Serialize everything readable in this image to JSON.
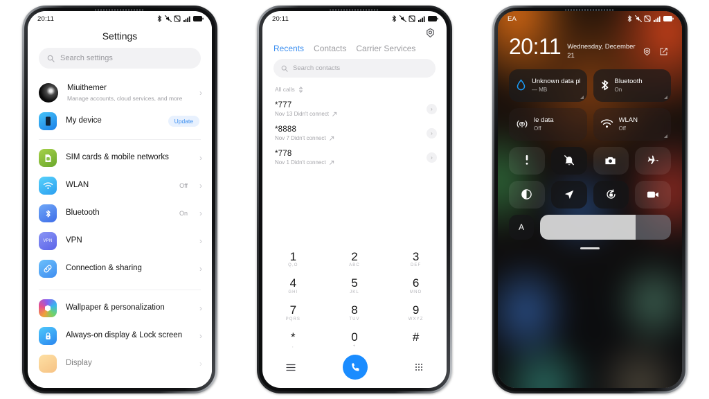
{
  "phones": {
    "settings": {
      "statusbar": {
        "time": "20:11",
        "icons": [
          "bluetooth-icon",
          "mute-icon",
          "no-sim-icon",
          "signal-icon",
          "battery-icon"
        ]
      },
      "title": "Settings",
      "search": {
        "placeholder": "Search settings",
        "icon": "search-icon"
      },
      "account": {
        "name": "Miuithemer",
        "subtitle": "Manage accounts, cloud services, and more",
        "avatar": "user-avatar"
      },
      "device": {
        "label": "My device",
        "badge": "Update",
        "icon": "phone-icon"
      },
      "items": [
        {
          "label": "SIM cards & mobile networks",
          "value": "",
          "icon": "sim-icon",
          "color": "#8bc34a"
        },
        {
          "label": "WLAN",
          "value": "Off",
          "icon": "wifi-icon",
          "color": "#4fc3f7"
        },
        {
          "label": "Bluetooth",
          "value": "On",
          "icon": "bluetooth-icon",
          "color": "#5b8dee"
        },
        {
          "label": "VPN",
          "value": "",
          "icon": "vpn-icon",
          "color": "#6c7bf0"
        },
        {
          "label": "Connection & sharing",
          "value": "",
          "icon": "link-icon",
          "color": "#5aa9f5"
        }
      ],
      "items2": [
        {
          "label": "Wallpaper & personalization",
          "value": "",
          "icon": "wallpaper-icon",
          "color": "#e75fa0"
        },
        {
          "label": "Always-on display & Lock screen",
          "value": "",
          "icon": "lock-icon",
          "color": "#38a8f0"
        },
        {
          "label": "Display",
          "value": "",
          "icon": "display-icon",
          "color": "#f5a623"
        }
      ]
    },
    "dialer": {
      "statusbar": {
        "time": "20:11"
      },
      "settings_icon": "gear-icon",
      "tabs": [
        {
          "label": "Recents",
          "active": true
        },
        {
          "label": "Contacts",
          "active": false
        },
        {
          "label": "Carrier Services",
          "active": false
        }
      ],
      "search": {
        "placeholder": "Search contacts",
        "icon": "search-icon"
      },
      "filter": {
        "label": "All calls",
        "icon": "sort-icon"
      },
      "calls": [
        {
          "number": "*777",
          "detail": "Nov 13 Didn't connect",
          "type": "outgoing-call-icon"
        },
        {
          "number": "*8888",
          "detail": "Nov 7 Didn't connect",
          "type": "outgoing-call-icon"
        },
        {
          "number": "*778",
          "detail": "Nov 1 Didn't connect",
          "type": "outgoing-call-icon"
        }
      ],
      "keypad": [
        {
          "num": "1",
          "letters": "Q,O"
        },
        {
          "num": "2",
          "letters": "ABC"
        },
        {
          "num": "3",
          "letters": "DEF"
        },
        {
          "num": "4",
          "letters": "GHI"
        },
        {
          "num": "5",
          "letters": "JKL"
        },
        {
          "num": "6",
          "letters": "MNO"
        },
        {
          "num": "7",
          "letters": "PQRS"
        },
        {
          "num": "8",
          "letters": "TUV"
        },
        {
          "num": "9",
          "letters": "WXYZ"
        },
        {
          "num": "*",
          "letters": ","
        },
        {
          "num": "0",
          "letters": "+"
        },
        {
          "num": "#",
          "letters": ""
        }
      ],
      "bottom": {
        "menu_icon": "menu-icon",
        "call_icon": "call-icon",
        "keypad_icon": "keypad-icon",
        "call_color": "#1a8cff"
      }
    },
    "controlcenter": {
      "statusbar": {
        "carrier": "EA"
      },
      "clock": {
        "time": "20:11",
        "date": "Wednesday, December 21"
      },
      "header_icons": [
        "gear-icon",
        "edit-icon"
      ],
      "tiles": [
        {
          "name": "Unknown data plan",
          "state": "— MB",
          "icon": "data-drop-icon",
          "on": true
        },
        {
          "name": "Bluetooth",
          "state": "On",
          "icon": "bluetooth-icon",
          "on": true
        },
        {
          "name": "le data",
          "state": "Off",
          "icon": "mobile-data-icon",
          "on": false
        },
        {
          "name": "WLAN",
          "state": "Off",
          "icon": "wifi-icon",
          "on": false
        }
      ],
      "mini_toggles": [
        {
          "icon": "flashlight-icon",
          "on": false
        },
        {
          "icon": "silent-icon",
          "on": true
        },
        {
          "icon": "camera-icon",
          "on": false
        },
        {
          "icon": "airplane-icon",
          "on": false
        },
        {
          "icon": "dark-mode-icon",
          "on": false
        },
        {
          "icon": "location-icon",
          "on": true
        },
        {
          "icon": "rotation-lock-icon",
          "on": true
        },
        {
          "icon": "screen-record-icon",
          "on": false
        }
      ],
      "brightness": {
        "auto_label": "A",
        "level": 73
      }
    }
  }
}
